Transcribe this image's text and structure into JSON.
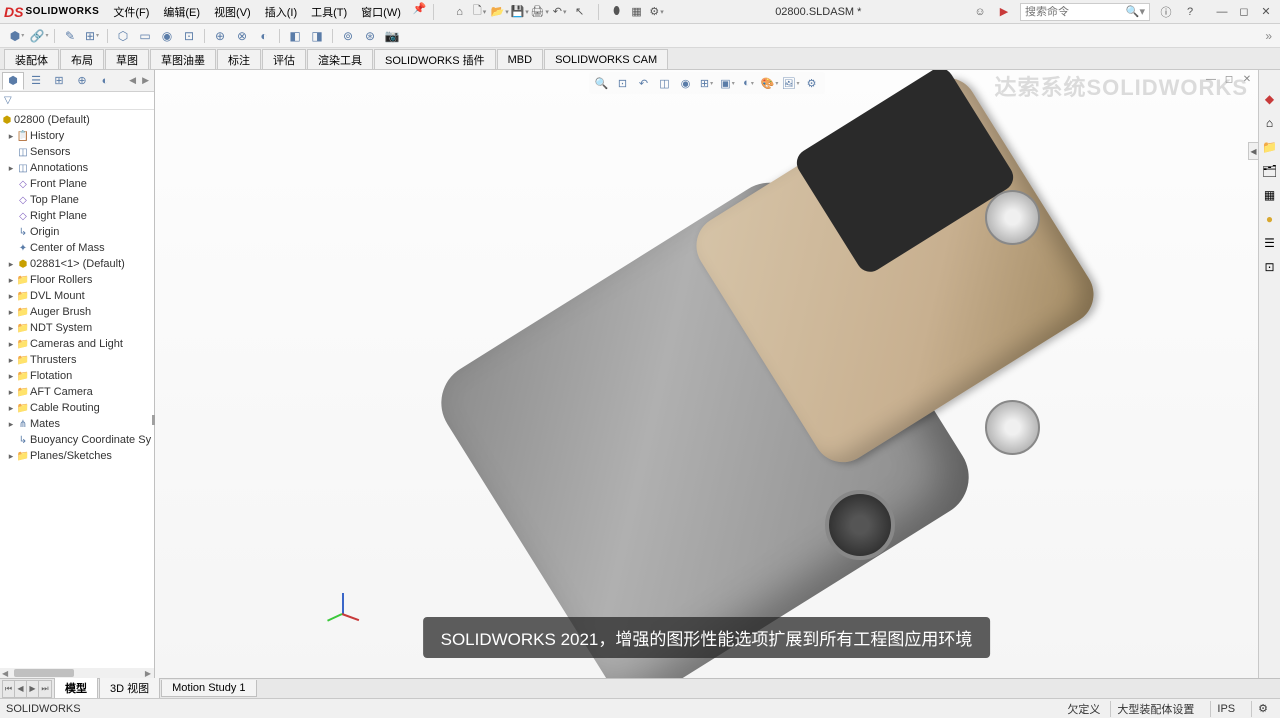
{
  "app": {
    "brand": "SOLIDWORKS",
    "doc_title": "02800.SLDASM *"
  },
  "menus": [
    "文件(F)",
    "编辑(E)",
    "视图(V)",
    "插入(I)",
    "工具(T)",
    "窗口(W)"
  ],
  "search": {
    "placeholder": "搜索命令"
  },
  "command_tabs": [
    "装配体",
    "布局",
    "草图",
    "草图油墨",
    "标注",
    "评估",
    "渲染工具",
    "SOLIDWORKS 插件",
    "MBD",
    "SOLIDWORKS CAM"
  ],
  "tree": {
    "root": "02800  (Default)",
    "items": [
      {
        "exp": "▸",
        "icon": "📋",
        "iconclass": "blue",
        "label": "History"
      },
      {
        "exp": "",
        "icon": "◫",
        "iconclass": "blue",
        "label": "Sensors"
      },
      {
        "exp": "▸",
        "icon": "◫",
        "iconclass": "blue",
        "label": "Annotations"
      },
      {
        "exp": "",
        "icon": "◇",
        "iconclass": "purple",
        "label": "Front Plane"
      },
      {
        "exp": "",
        "icon": "◇",
        "iconclass": "purple",
        "label": "Top Plane"
      },
      {
        "exp": "",
        "icon": "◇",
        "iconclass": "purple",
        "label": "Right Plane"
      },
      {
        "exp": "",
        "icon": "↳",
        "iconclass": "blue",
        "label": "Origin"
      },
      {
        "exp": "",
        "icon": "✦",
        "iconclass": "blue",
        "label": "Center of Mass"
      },
      {
        "exp": "▸",
        "icon": "⬢",
        "iconclass": "gold",
        "label": "02881<1> (Default)"
      },
      {
        "exp": "▸",
        "icon": "📁",
        "iconclass": "folder",
        "label": "Floor Rollers"
      },
      {
        "exp": "▸",
        "icon": "📁",
        "iconclass": "folder",
        "label": "DVL Mount"
      },
      {
        "exp": "▸",
        "icon": "📁",
        "iconclass": "folder",
        "label": "Auger Brush"
      },
      {
        "exp": "▸",
        "icon": "📁",
        "iconclass": "folder",
        "label": "NDT System"
      },
      {
        "exp": "▸",
        "icon": "📁",
        "iconclass": "folder",
        "label": "Cameras and Light"
      },
      {
        "exp": "▸",
        "icon": "📁",
        "iconclass": "folder",
        "label": "Thrusters"
      },
      {
        "exp": "▸",
        "icon": "📁",
        "iconclass": "folder",
        "label": "Flotation"
      },
      {
        "exp": "▸",
        "icon": "📁",
        "iconclass": "folder",
        "label": "AFT Camera"
      },
      {
        "exp": "▸",
        "icon": "📁",
        "iconclass": "folder",
        "label": "Cable Routing"
      },
      {
        "exp": "▸",
        "icon": "⋔",
        "iconclass": "blue",
        "label": "Mates"
      },
      {
        "exp": "",
        "icon": "↳",
        "iconclass": "blue",
        "label": "Buoyancy Coordinate Sy"
      },
      {
        "exp": "▸",
        "icon": "📁",
        "iconclass": "gray",
        "label": "Planes/Sketches"
      }
    ]
  },
  "bottom_tabs": [
    "模型",
    "3D 视图",
    "Motion Study 1"
  ],
  "status": {
    "left": "SOLIDWORKS",
    "right1": "欠定义",
    "right2": "大型装配体设置",
    "right3": "IPS"
  },
  "watermark": "达索系统SOLIDWORKS",
  "subtitle": "SOLIDWORKS 2021，增强的图形性能选项扩展到所有工程图应用环境"
}
